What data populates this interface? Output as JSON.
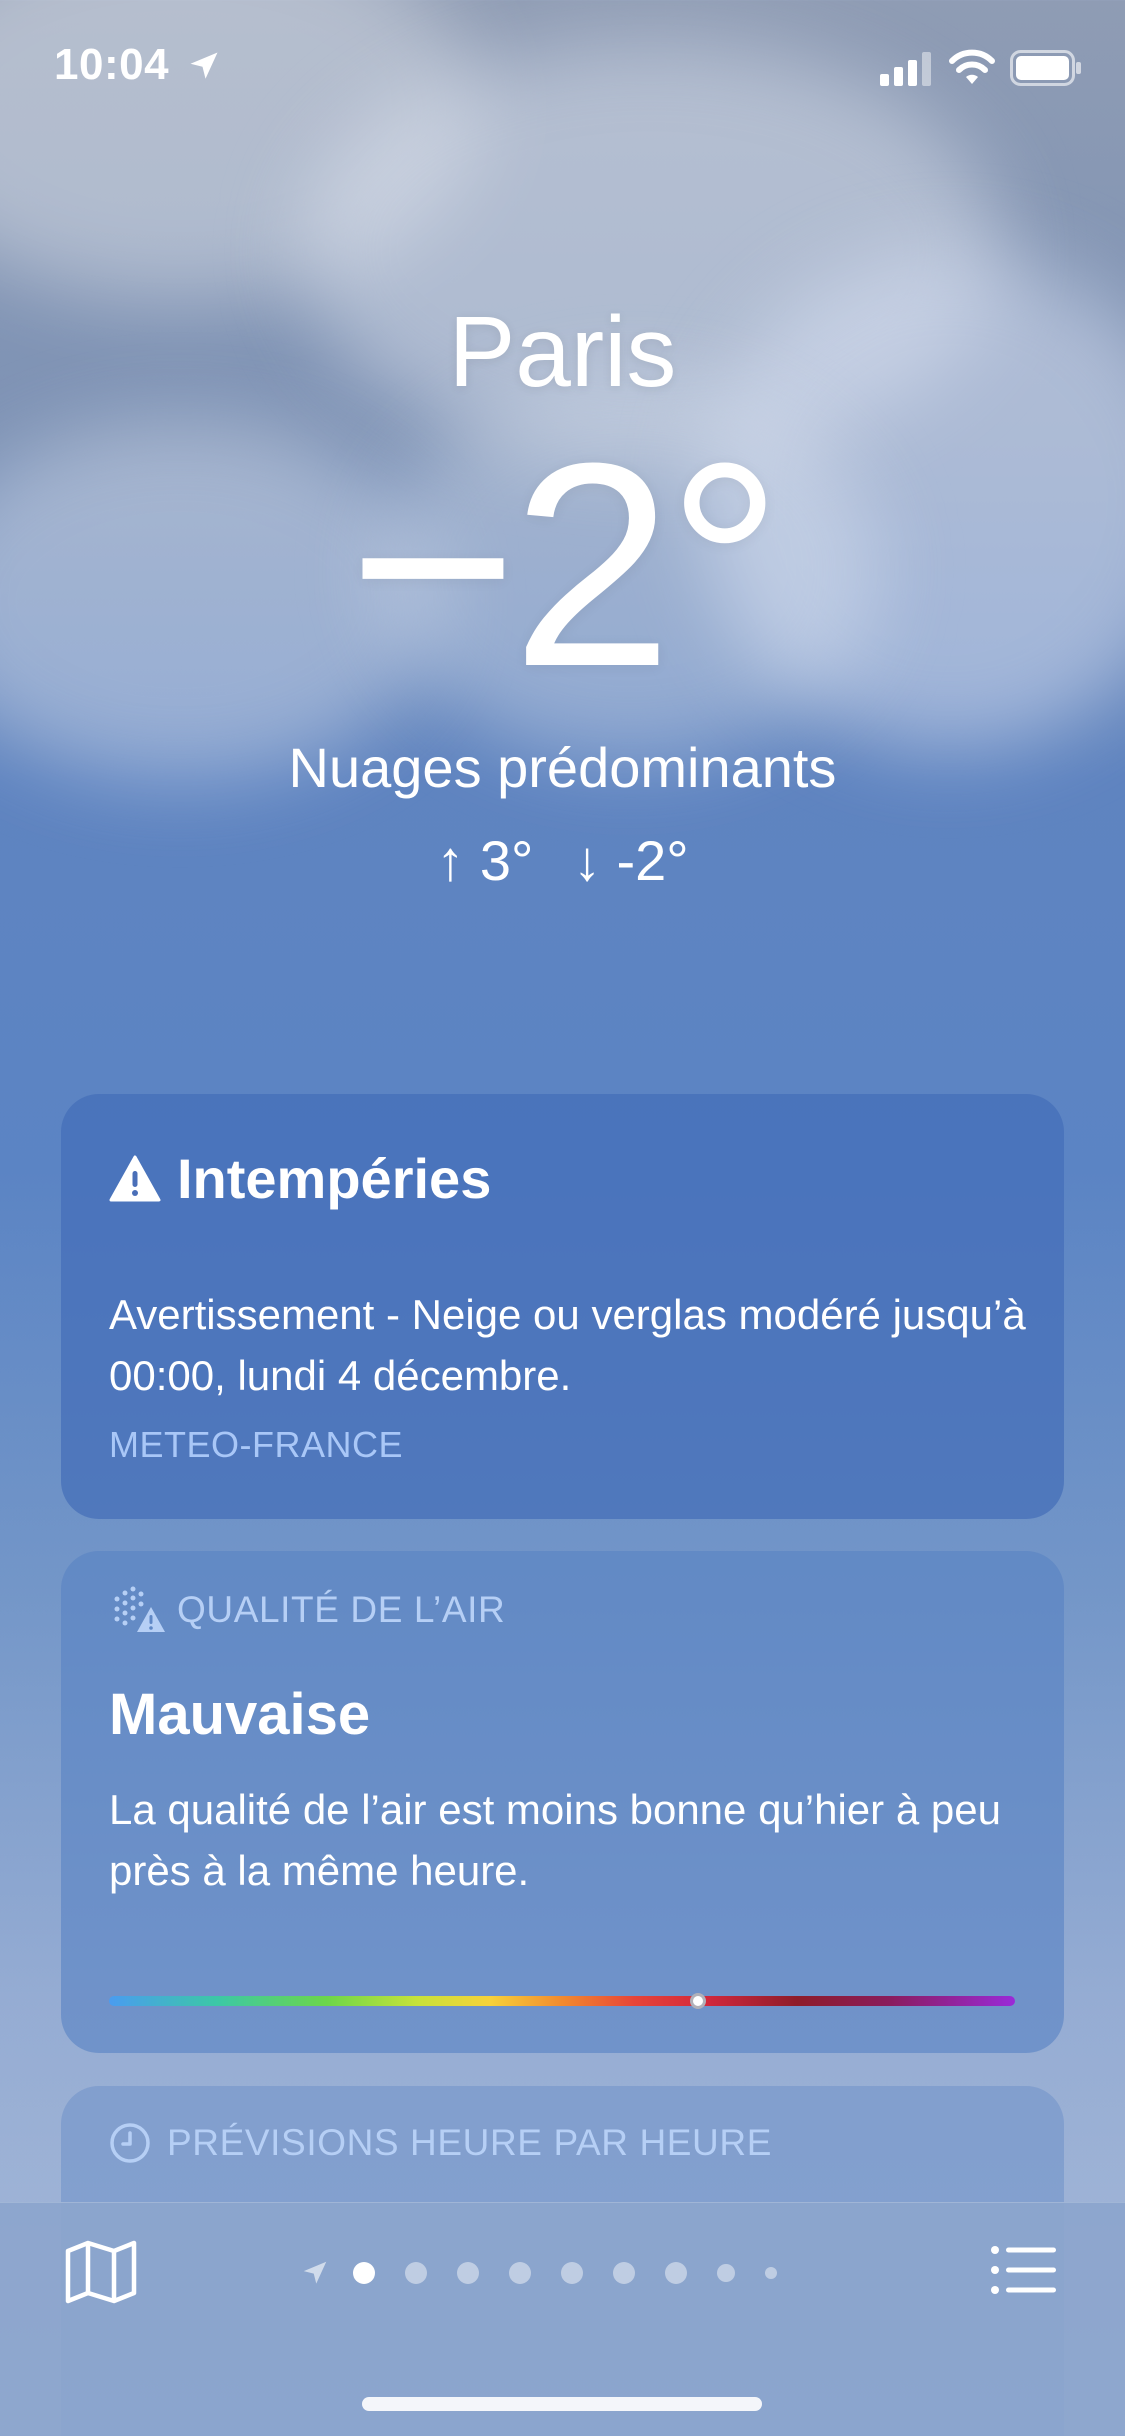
{
  "status_bar": {
    "time": "10:04"
  },
  "hero": {
    "city": "Paris",
    "temperature": "−2°",
    "condition": "Nuages prédominants",
    "high": "↑ 3°",
    "low": "↓ -2°"
  },
  "alert_card": {
    "title": "Intempéries",
    "text": "Avertissement - Neige ou verglas modéré jusqu’à 00:00, lundi 4 décembre.",
    "source": "METEO-FRANCE"
  },
  "air_quality_card": {
    "label": "QUALITÉ DE L’AIR",
    "value": "Mauvaise",
    "text": "La qualité de l’air est moins bonne qu’hier à peu près à la même heure.",
    "level_fraction": 0.65
  },
  "hourly_card": {
    "label": "PRÉVISIONS HEURE PAR HEURE"
  },
  "bottom_bar": {
    "page_count": 9,
    "active_page": 1,
    "icons": [
      "map-icon",
      "location-arrow-icon",
      "list-icon"
    ]
  }
}
